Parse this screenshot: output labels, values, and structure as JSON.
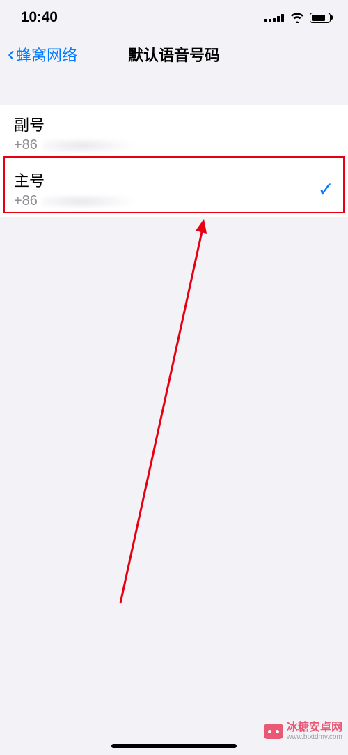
{
  "status": {
    "time": "10:40"
  },
  "nav": {
    "back_label": "蜂窝网络",
    "title": "默认语音号码"
  },
  "lines": [
    {
      "title": "副号",
      "prefix": "+86",
      "selected": false
    },
    {
      "title": "主号",
      "prefix": "+86",
      "selected": true
    }
  ],
  "annotation": {
    "highlight_color": "#e60012"
  },
  "watermark": {
    "brand": "冰糖安卓网",
    "url": "www.btxtdmy.com"
  }
}
